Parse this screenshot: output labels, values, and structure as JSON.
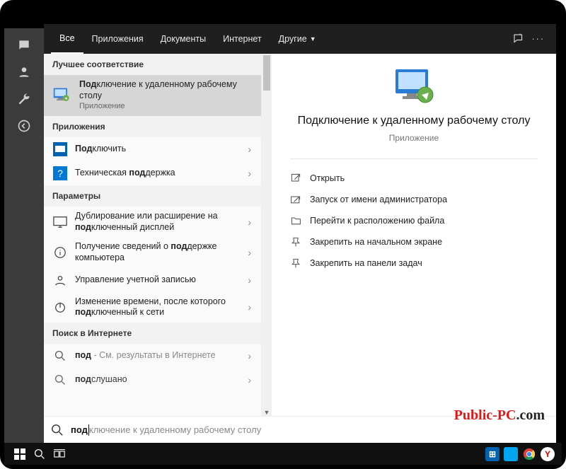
{
  "tabs": {
    "all": "Все",
    "apps": "Приложения",
    "docs": "Документы",
    "web": "Интернет",
    "more": "Другие"
  },
  "sections": {
    "best": "Лучшее соответствие",
    "apps": "Приложения",
    "settings": "Параметры",
    "web": "Поиск в Интернете"
  },
  "best": {
    "prefix": "Под",
    "rest": "ключение к удаленному рабочему столу",
    "sub": "Приложение"
  },
  "apps_list": [
    {
      "prefix": "Под",
      "rest": "ключить"
    },
    {
      "plain_before": "Техническая ",
      "bold": "под",
      "plain_after": "держка"
    }
  ],
  "settings_list": [
    {
      "plain_before": "Дублирование или расширение на ",
      "bold": "под",
      "plain_after": "ключенный дисплей"
    },
    {
      "plain_before": "Получение сведений о ",
      "bold": "под",
      "plain_after": "держке компьютера"
    },
    {
      "plain_before": "Управление учетной записью",
      "bold": "",
      "plain_after": ""
    },
    {
      "plain_before": "Изменение времени, после которого ",
      "bold": "под",
      "plain_after": "ключенный к сети"
    }
  ],
  "web_list": [
    {
      "bold": "под",
      "hint": " - См. результаты в Интернете"
    },
    {
      "bold": "под",
      "plain_after": "слушано"
    }
  ],
  "preview": {
    "title": "Подключение к удаленному рабочему столу",
    "sub": "Приложение"
  },
  "actions": {
    "open": "Открыть",
    "admin": "Запуск от имени администратора",
    "location": "Перейти к расположению файла",
    "pin_start": "Закрепить на начальном экране",
    "pin_taskbar": "Закрепить на панели задач"
  },
  "search": {
    "typed": "под",
    "ghost": "ключение к удаленному рабочему столу"
  },
  "watermark": {
    "a": "Public-PC",
    "b": ".com"
  }
}
